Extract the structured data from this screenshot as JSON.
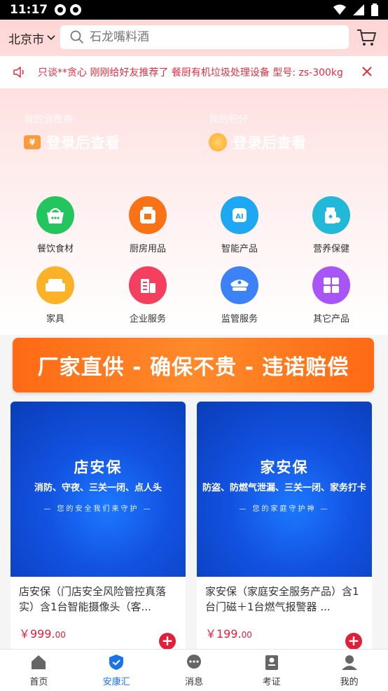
{
  "status": {
    "time": "11:17"
  },
  "header": {
    "city": "北京市",
    "search_placeholder": "石龙嘴料酒"
  },
  "notice": {
    "text": "只谈**贪心 刚刚给好友推荐了 餐厨有机垃圾处理设备 型号: zs-300kg"
  },
  "assets": [
    {
      "label": "我的消费券:",
      "value": "登录后查看"
    },
    {
      "label": "我的积分:",
      "value": "登录后查看"
    }
  ],
  "categories": [
    {
      "label": "餐饮食材",
      "color": "#22c55e"
    },
    {
      "label": "厨房用品",
      "color": "#f97316"
    },
    {
      "label": "智能产品",
      "color": "#1ea7f2"
    },
    {
      "label": "营养保健",
      "color": "#22b8d8"
    },
    {
      "label": "家具",
      "color": "#fbb226"
    },
    {
      "label": "企业服务",
      "color": "#f43f5e"
    },
    {
      "label": "监管服务",
      "color": "#3b82f6"
    },
    {
      "label": "其它产品",
      "color": "#a855f7"
    }
  ],
  "banner": {
    "text": "厂家直供 - 确保不贵 - 违诺赔偿"
  },
  "products": [
    {
      "img_title": "店安保",
      "img_sub": "消防、守夜、三关一闭、点人头",
      "img_slogan": "— 您的安全我们来守护 —",
      "title": "店安保（门店安全风险管控真落实）含1台智能摄像头（客...",
      "price_main": "￥999.",
      "price_dec": "00"
    },
    {
      "img_title": "家安保",
      "img_sub": "防盗、防燃气泄漏、三关一闭、家务打卡",
      "img_slogan": "— 您的家庭守护神 —",
      "title": "家安保（家庭安全服务产品）含1台门磁＋1台燃气报警器 ...",
      "price_main": "￥199.",
      "price_dec": "00"
    }
  ],
  "tabs": [
    {
      "label": "首页"
    },
    {
      "label": "安康汇"
    },
    {
      "label": "消息"
    },
    {
      "label": "考证"
    },
    {
      "label": "我的"
    }
  ],
  "colors": {
    "accent": "#1a73e8",
    "price": "#e0203a",
    "notice": "#e03040"
  }
}
